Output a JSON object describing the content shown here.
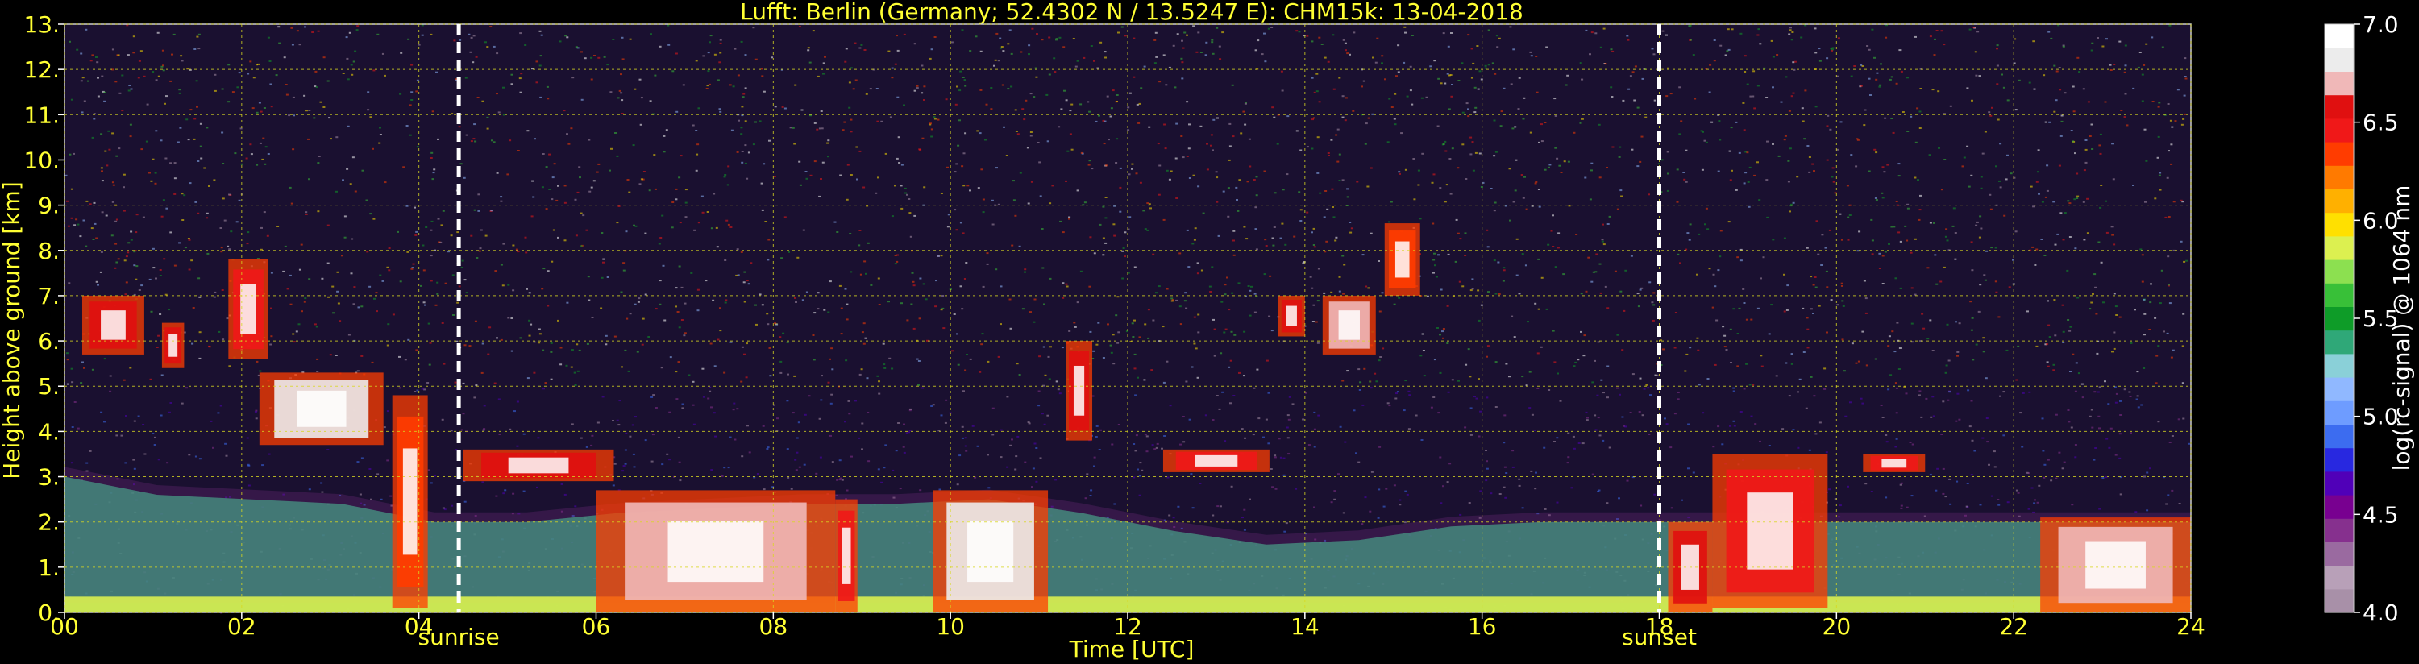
{
  "chart_data": {
    "type": "heatmap",
    "title": "Lufft: Berlin (Germany; 52.4302 N / 13.5247 E):    CHM15k: 13-04-2018",
    "xlabel": "Time [UTC]",
    "ylabel": "Height above ground [km]",
    "xlim": [
      0,
      24
    ],
    "ylim": [
      0,
      13
    ],
    "x_ticks": [
      0,
      2,
      4,
      6,
      8,
      10,
      12,
      14,
      16,
      18,
      20,
      22,
      24
    ],
    "x_tick_labels": [
      "00",
      "02",
      "04",
      "06",
      "08",
      "10",
      "12",
      "14",
      "16",
      "18",
      "20",
      "22",
      "24"
    ],
    "y_ticks": [
      0,
      1,
      2,
      3,
      4,
      5,
      6,
      7,
      8,
      9,
      10,
      11,
      12,
      13
    ],
    "y_tick_labels": [
      "0.",
      "1.",
      "2.",
      "3.",
      "4.",
      "5.",
      "6.",
      "7.",
      "8.",
      "9.",
      "10.",
      "11.",
      "12.",
      "13."
    ],
    "grid": true,
    "events": [
      {
        "label": "sunrise",
        "time": 4.45
      },
      {
        "label": "sunset",
        "time": 18.0
      }
    ],
    "colorbar": {
      "label": "log(rc-signal) @ 1064 nm",
      "range": [
        4.0,
        7.0
      ],
      "tick_values": [
        4.0,
        4.5,
        5.0,
        5.5,
        6.0,
        6.5,
        7.0
      ],
      "tick_labels": [
        "4.0",
        "4.5",
        "5.0",
        "5.5",
        "6.0",
        "6.5",
        "7.0"
      ],
      "colors": [
        "#a890a8",
        "#b8a0b8",
        "#9a6aa0",
        "#86308e",
        "#780090",
        "#5000b8",
        "#2828e0",
        "#3c6cf0",
        "#6e9cff",
        "#90b8ff",
        "#8ad0d8",
        "#2fa878",
        "#0e9c28",
        "#38c038",
        "#8ce050",
        "#dcf050",
        "#ffe000",
        "#ffb000",
        "#ff7a00",
        "#ff3c00",
        "#f01818",
        "#e01010",
        "#f0b8b8",
        "#ececec",
        "#ffffff"
      ]
    },
    "features": [
      {
        "kind": "boundary-layer",
        "t_start": 0.0,
        "t_end": 24.0,
        "top_km": [
          3.0,
          2.6,
          2.5,
          2.4,
          2.0,
          2.0,
          2.2,
          2.3,
          2.4,
          2.4,
          2.5,
          2.2,
          1.8,
          1.5,
          1.6,
          1.9,
          2.0,
          2.0,
          2.0,
          2.0,
          2.0,
          2.0,
          2.0,
          2.0
        ],
        "level": 5.4
      },
      {
        "kind": "near-surface-layer",
        "t_start": 0.0,
        "t_end": 24.0,
        "top_km": 0.35,
        "level": 5.8
      },
      {
        "kind": "cloud",
        "t_start": 0.2,
        "t_end": 0.9,
        "base_km": 5.7,
        "top_km": 7.0,
        "level": 6.6
      },
      {
        "kind": "cloud",
        "t_start": 1.1,
        "t_end": 1.35,
        "base_km": 5.4,
        "top_km": 6.4,
        "level": 6.6
      },
      {
        "kind": "cloud",
        "t_start": 1.85,
        "t_end": 2.3,
        "base_km": 5.6,
        "top_km": 7.8,
        "level": 6.5
      },
      {
        "kind": "cloud",
        "t_start": 2.2,
        "t_end": 3.6,
        "base_km": 3.7,
        "top_km": 5.3,
        "level": 6.8
      },
      {
        "kind": "cloud",
        "t_start": 3.7,
        "t_end": 4.1,
        "base_km": 0.1,
        "top_km": 4.8,
        "level": 6.3
      },
      {
        "kind": "cloud",
        "t_start": 4.5,
        "t_end": 6.2,
        "base_km": 2.9,
        "top_km": 3.6,
        "level": 6.6
      },
      {
        "kind": "cloud",
        "t_start": 6.0,
        "t_end": 8.7,
        "base_km": 0.0,
        "top_km": 2.7,
        "level": 6.7
      },
      {
        "kind": "cloud",
        "t_start": 8.7,
        "t_end": 8.95,
        "base_km": 0.0,
        "top_km": 2.5,
        "level": 6.4
      },
      {
        "kind": "cloud",
        "t_start": 9.8,
        "t_end": 11.1,
        "base_km": 0.0,
        "top_km": 2.7,
        "level": 6.8
      },
      {
        "kind": "cloud",
        "t_start": 11.3,
        "t_end": 11.6,
        "base_km": 3.8,
        "top_km": 6.0,
        "level": 6.6
      },
      {
        "kind": "cloud",
        "t_start": 12.4,
        "t_end": 13.6,
        "base_km": 3.1,
        "top_km": 3.6,
        "level": 6.5
      },
      {
        "kind": "cloud",
        "t_start": 13.7,
        "t_end": 14.0,
        "base_km": 6.1,
        "top_km": 7.0,
        "level": 6.6
      },
      {
        "kind": "cloud",
        "t_start": 14.2,
        "t_end": 14.8,
        "base_km": 5.7,
        "top_km": 7.0,
        "level": 6.7
      },
      {
        "kind": "cloud",
        "t_start": 14.9,
        "t_end": 15.3,
        "base_km": 7.0,
        "top_km": 8.6,
        "level": 6.3
      },
      {
        "kind": "cloud",
        "t_start": 18.1,
        "t_end": 18.6,
        "base_km": 0.0,
        "top_km": 2.0,
        "level": 6.6
      },
      {
        "kind": "cloud",
        "t_start": 18.6,
        "t_end": 19.9,
        "base_km": 0.1,
        "top_km": 3.5,
        "level": 6.5
      },
      {
        "kind": "cloud",
        "t_start": 20.3,
        "t_end": 21.0,
        "base_km": 3.1,
        "top_km": 3.5,
        "level": 6.4
      },
      {
        "kind": "cloud",
        "t_start": 22.3,
        "t_end": 24.0,
        "base_km": 0.0,
        "top_km": 2.1,
        "level": 6.7
      }
    ]
  }
}
